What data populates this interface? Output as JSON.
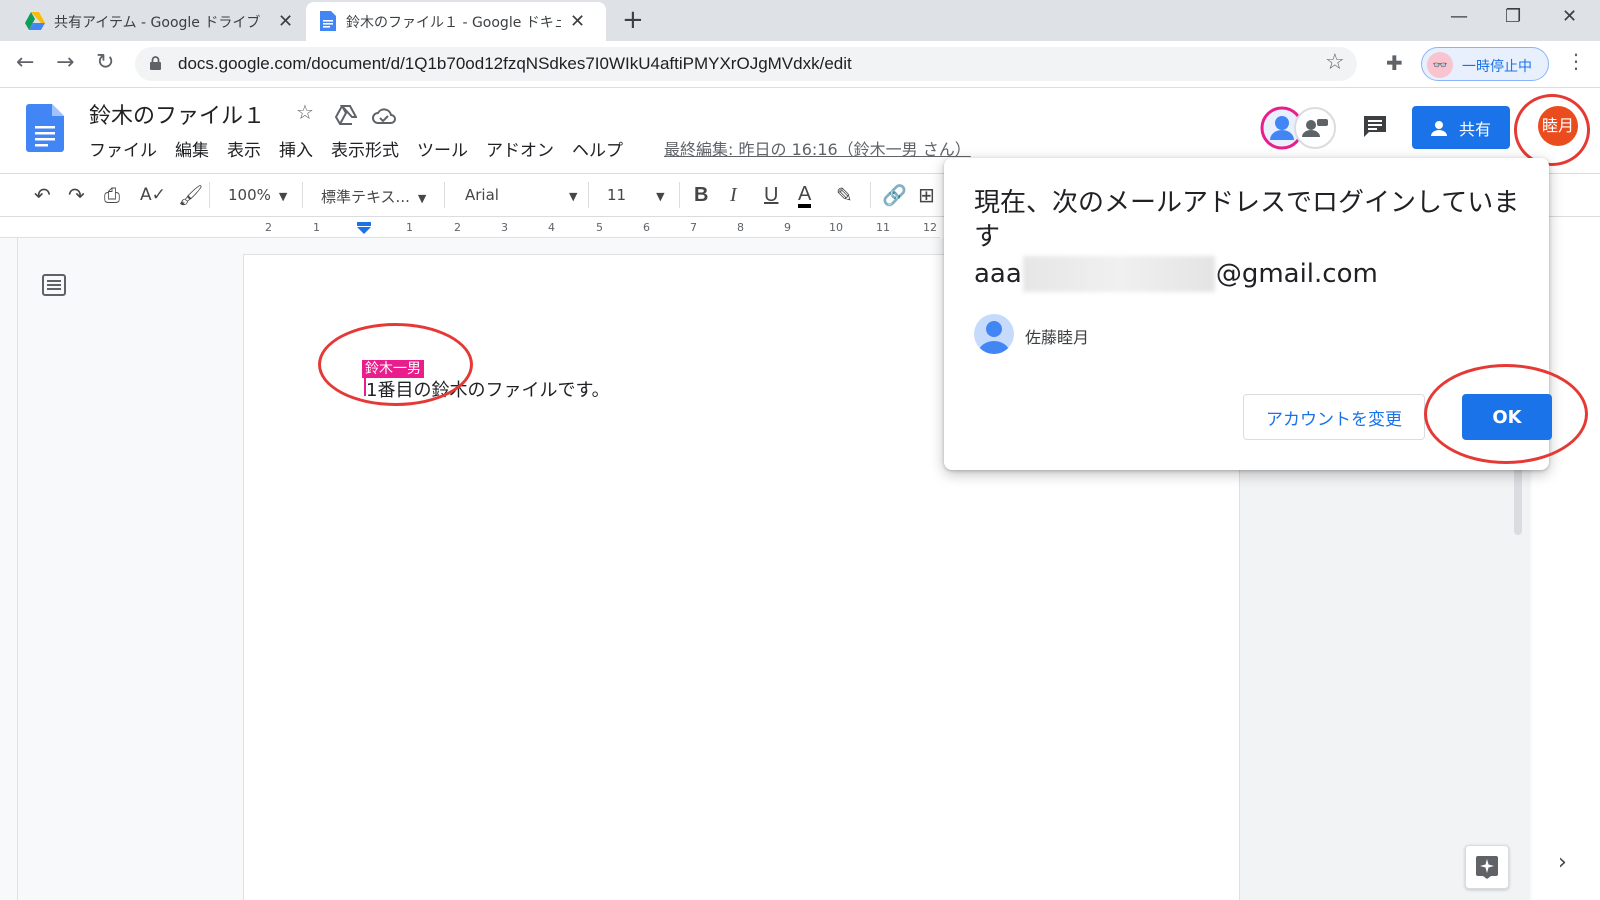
{
  "browser": {
    "tabs": [
      {
        "title": "共有アイテム - Google ドライブ",
        "icon": "google-drive-icon"
      },
      {
        "title": "鈴木のファイル１ - Google ドキュメン",
        "icon": "google-docs-icon"
      }
    ],
    "url": "docs.google.com/document/d/1Q1b70od12fzqNSdkes7I0WIkU4aftiPMYXrOJgMVdxk/edit",
    "profile_label": "一時停止中"
  },
  "doc": {
    "title": "鈴木のファイル１",
    "menus": [
      "ファイル",
      "編集",
      "表示",
      "挿入",
      "表示形式",
      "ツール",
      "アドオン",
      "ヘルプ"
    ],
    "last_edit": "最終編集: 昨日の 16:16（鈴木一男 さん）",
    "share_label": "共有",
    "user_avatar": "睦月",
    "body_text": "1番目の鈴木のファイルです。",
    "cursor_label": "鈴木一男"
  },
  "toolbar": {
    "zoom": "100%",
    "style": "標準テキス...",
    "font": "Arial",
    "size": "11"
  },
  "ruler": {
    "marks": [
      "2",
      "1",
      "1",
      "2",
      "3",
      "4",
      "5",
      "6",
      "7",
      "8",
      "9",
      "10",
      "11",
      "12"
    ]
  },
  "dialog": {
    "message": "現在、次のメールアドレスでログインしています",
    "email_prefix": "aaa",
    "email_suffix": "@gmail.com",
    "person": "佐藤睦月",
    "change_account": "アカウントを変更",
    "ok": "OK"
  },
  "colors": {
    "primary": "#1a73e8",
    "avatar": "#ea4c1e",
    "cursor": "#e91e8c",
    "annotation": "#e53935"
  }
}
